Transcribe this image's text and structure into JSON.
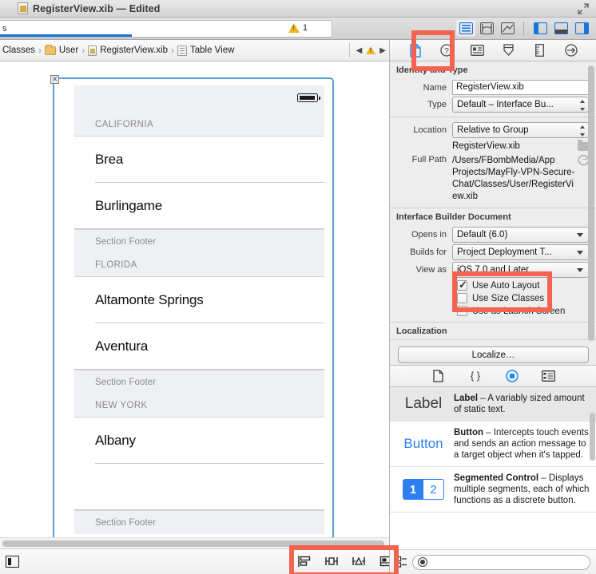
{
  "window": {
    "title": "RegisterView.xib — Edited",
    "doc_icon": "xib-document-icon",
    "fullscreen_icon": "fullscreen-icon"
  },
  "toolbar": {
    "activity": {
      "text": "s",
      "warning_count": "1",
      "warning_icon": "warning-triangle-icon",
      "progress_percent": 40
    },
    "editor_modes": [
      {
        "name": "standard-editor",
        "icon": "standard-editor-icon",
        "active": true
      },
      {
        "name": "assistant-editor",
        "icon": "assistant-editor-icon",
        "active": false
      },
      {
        "name": "version-editor",
        "icon": "version-editor-icon",
        "active": false
      }
    ],
    "view_toggles": [
      {
        "name": "navigator-toggle",
        "icon": "left-panel-icon",
        "active": true
      },
      {
        "name": "debug-area-toggle",
        "icon": "bottom-panel-icon",
        "active": true
      },
      {
        "name": "utilities-toggle",
        "icon": "right-panel-icon",
        "active": true
      }
    ]
  },
  "jumpbar": {
    "crumbs": [
      {
        "label": "Classes",
        "icon": "none"
      },
      {
        "label": "User",
        "icon": "folder-icon"
      },
      {
        "label": "RegisterView.xib",
        "icon": "xib-file-icon"
      },
      {
        "label": "Table View",
        "icon": "table-view-icon"
      }
    ],
    "separator": "›",
    "back_arrow": "◀",
    "forward_arrow": "▶",
    "warning_icon": "warning-triangle-icon"
  },
  "canvas": {
    "selection_handle_icon": "close-handle-icon",
    "table": {
      "sections": [
        {
          "header": "CALIFORNIA",
          "cells": [
            "Brea",
            "Burlingame"
          ],
          "footer": "Section Footer"
        },
        {
          "header": "FLORIDA",
          "cells": [
            "Altamonte Springs",
            "Aventura"
          ],
          "footer": "Section Footer"
        },
        {
          "header": "NEW YORK",
          "cells": [
            "Albany",
            ""
          ],
          "footer": "Section Footer"
        }
      ]
    }
  },
  "bottombar": {
    "panel_toggle_icon": "show-document-outline-icon",
    "autolayout_buttons": [
      {
        "name": "align-button",
        "icon": "align-icon"
      },
      {
        "name": "pin-button",
        "icon": "pin-icon"
      },
      {
        "name": "resolve-issues-button",
        "icon": "resolve-issues-icon"
      },
      {
        "name": "resizing-behavior-button",
        "icon": "resizing-behavior-icon"
      }
    ]
  },
  "inspector": {
    "tabs": [
      {
        "name": "file-inspector",
        "icon": "file-icon",
        "active": true
      },
      {
        "name": "quick-help-inspector",
        "icon": "question-icon",
        "active": false
      },
      {
        "name": "identity-inspector",
        "icon": "identity-card-icon",
        "active": false
      },
      {
        "name": "attributes-inspector",
        "icon": "attributes-slider-icon",
        "active": false
      },
      {
        "name": "size-inspector",
        "icon": "ruler-icon",
        "active": false
      },
      {
        "name": "connections-inspector",
        "icon": "connections-arrow-icon",
        "active": false
      }
    ],
    "identity_and_type": {
      "title": "Identity and Type",
      "name_label": "Name",
      "name_value": "RegisterView.xib",
      "type_label": "Type",
      "type_value": "Default – Interface Bu...",
      "location_label": "Location",
      "location_value": "Relative to Group",
      "location_filename": "RegisterView.xib",
      "folder_icon": "folder-icon",
      "full_path_label": "Full Path",
      "full_path_value": "/Users/FBombMedia/App Projects/MayFly-VPN-Secure-Chat/Classes/User/RegisterView.xib",
      "reveal_icon": "reveal-in-finder-icon"
    },
    "interface_builder_document": {
      "title": "Interface Builder Document",
      "opens_in_label": "Opens in",
      "opens_in_value": "Default (6.0)",
      "builds_for_label": "Builds for",
      "builds_for_value": "Project Deployment T...",
      "view_as_label": "View as",
      "view_as_value": "iOS 7.0 and Later",
      "checkboxes": [
        {
          "label": "Use Auto Layout",
          "checked": true
        },
        {
          "label": "Use Size Classes",
          "checked": false
        },
        {
          "label": "Use as Launch Screen",
          "checked": false
        }
      ]
    },
    "localization": {
      "title": "Localization",
      "button_label": "Localize…"
    }
  },
  "library": {
    "tabs": [
      {
        "name": "file-template-library",
        "icon": "file-icon",
        "active": false
      },
      {
        "name": "code-snippet-library",
        "icon": "braces-icon",
        "active": false
      },
      {
        "name": "object-library",
        "icon": "object-circle-icon",
        "active": true
      },
      {
        "name": "media-library",
        "icon": "media-icon",
        "active": false
      }
    ],
    "items": [
      {
        "preview": "Label",
        "preview_type": "label",
        "title": "Label",
        "dash": " – ",
        "description": "A variably sized amount of static text.",
        "selected": true
      },
      {
        "preview": "Button",
        "preview_type": "button",
        "title": "Button",
        "dash": " – ",
        "description": "Intercepts touch events and sends an action message to a target object when it's tapped.",
        "selected": false
      },
      {
        "preview": "1 2",
        "preview_type": "segmented",
        "seg_1": "1",
        "seg_2": "2",
        "title": "Segmented Control",
        "dash": " – ",
        "description": "Displays multiple segments, each of which functions as a discrete button.",
        "selected": false
      }
    ],
    "filter": {
      "placeholder": "",
      "value": "",
      "search_icon": "search-icon",
      "grid_icon": "library-grid-icon"
    }
  },
  "annotations": {
    "accent_color": "#f4634f",
    "boxes": [
      {
        "name": "file-inspector-tab-highlight"
      },
      {
        "name": "use-auto-layout-highlight"
      },
      {
        "name": "autolayout-toolbar-highlight"
      }
    ]
  }
}
